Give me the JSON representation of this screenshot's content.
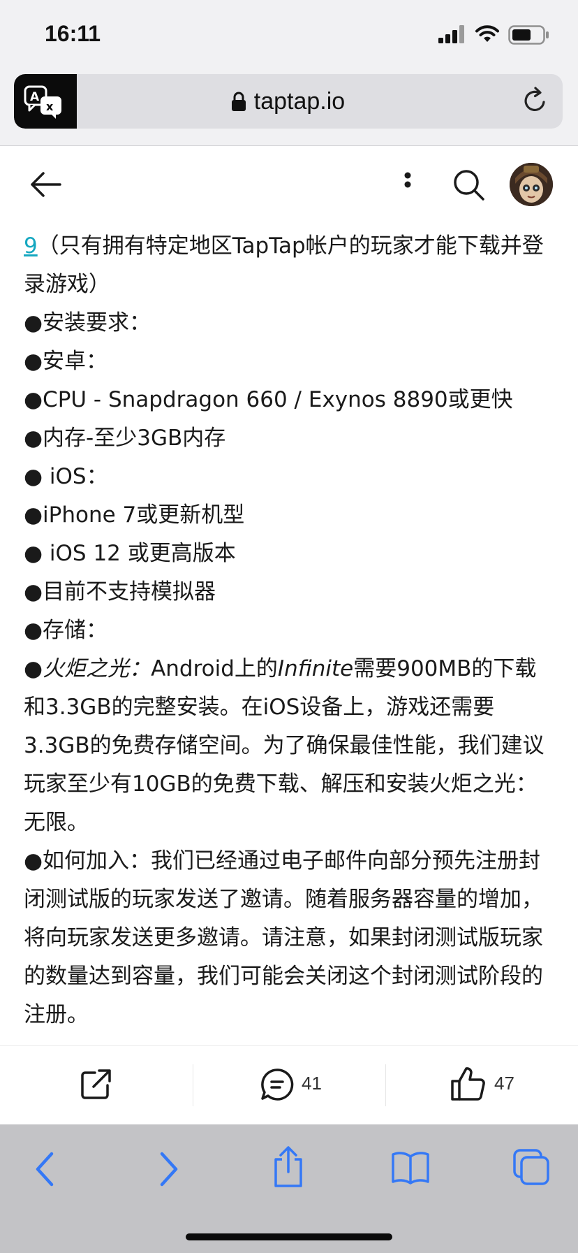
{
  "status_bar": {
    "time": "16:11"
  },
  "browser": {
    "url": "taptap.io",
    "translate_icon": "translate-icon",
    "lock_icon": "lock-icon",
    "reload_icon": "reload-icon"
  },
  "header": {
    "back_icon": "back-arrow-icon",
    "more_icon": "more-vertical-icon",
    "search_icon": "search-icon",
    "avatar": "avatar"
  },
  "article": {
    "link_text": "9",
    "line0_rest": "（只有拥有特定地区TapTap帐户的玩家才能下载并登录游戏）",
    "lines": [
      "●安装要求：",
      "●安卓：",
      "●CPU - Snapdragon 660 / Exynos 8890或更快",
      "●内存-至少3GB内存",
      "● iOS：",
      "●iPhone 7或更新机型",
      "● iOS 12 或更高版本",
      "●目前不支持模拟器",
      "●存储："
    ],
    "storage_prefix": "●",
    "storage_game_italic": "火炬之光：",
    "storage_mid": "Android上的",
    "storage_infinite_italic": "Infinite",
    "storage_rest": "需要900MB的下载和3.3GB的完整安装。在iOS设备上，游戏还需要3.3GB的免费存储空间。为了确保最佳性能，我们建议玩家至少有10GB的免费下载、解压和安装火炬之光：无限。",
    "join_paragraph": "●如何加入：我们已经通过电子邮件向部分预先注册封闭测试版的玩家发送了邀请。随着服务器容量的增加，将向玩家发送更多邀请。请注意，如果封闭测试版玩家的数量达到容量，我们可能会关闭这个封闭测试阶段的注册。"
  },
  "actions": {
    "share_icon": "share-icon",
    "comment_icon": "comment-icon",
    "comment_count": "41",
    "like_icon": "thumbs-up-icon",
    "like_count": "47"
  },
  "toolbar": {
    "items": [
      "chevron-left-icon",
      "chevron-right-icon",
      "share-upload-icon",
      "bookmarks-icon",
      "tabs-icon"
    ],
    "accent": "#3478f6"
  }
}
